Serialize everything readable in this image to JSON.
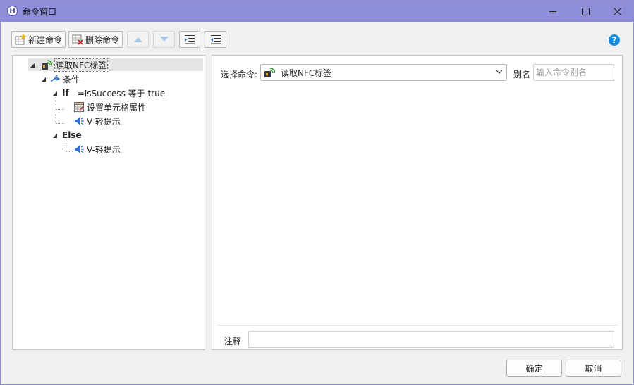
{
  "window": {
    "title": "命令窗口"
  },
  "toolbar": {
    "new_command": "新建命令",
    "delete_command": "删除命令"
  },
  "tree": {
    "root": "读取NFC标签",
    "condition": "条件",
    "if_keyword": "If",
    "if_expression": "=IsSuccess 等于 true",
    "if_children": [
      "设置单元格属性",
      "V-轻提示"
    ],
    "else_keyword": "Else",
    "else_children": [
      "V-轻提示"
    ]
  },
  "editor": {
    "select_command_label": "选择命令:",
    "selected_command": "读取NFC标签",
    "alias_label": "别名",
    "alias_placeholder": "输入命令别名",
    "note_label": "注释",
    "note_value": ""
  },
  "buttons": {
    "ok": "确定",
    "cancel": "取消"
  },
  "colors": {
    "titlebar": "#8e8ed8",
    "help": "#1a8ce0",
    "arrow_disabled": "#a9c7ea"
  }
}
